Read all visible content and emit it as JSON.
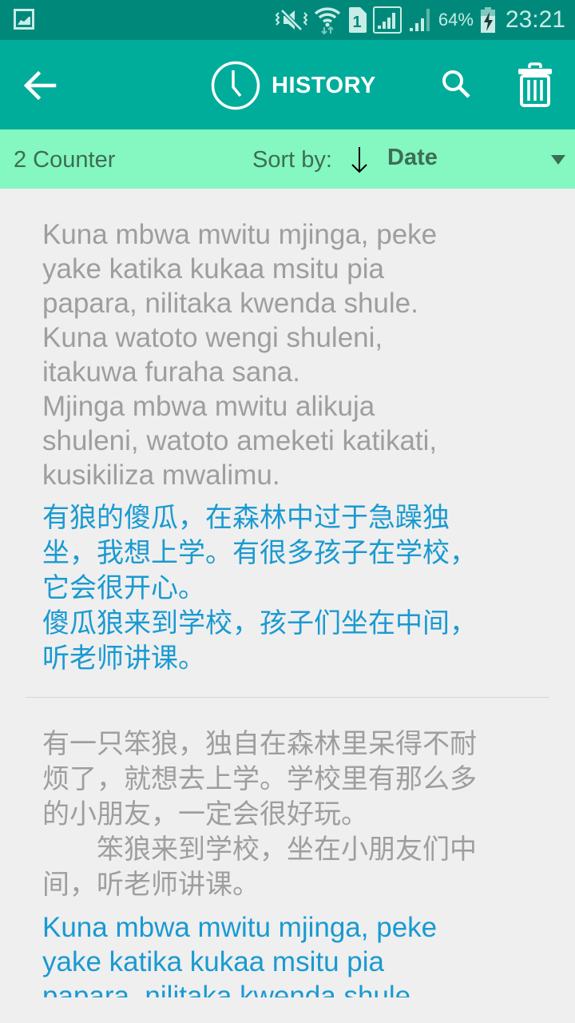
{
  "status_bar": {
    "battery": "64%",
    "time": "23:21",
    "icons": [
      "gallery-notification-icon",
      "vibrate-mute-icon",
      "wifi-icon",
      "sim1-icon",
      "signal-sim1-icon",
      "signal-sim2-icon",
      "battery-charging-icon"
    ],
    "sim_label": "1"
  },
  "app_bar": {
    "title": "HISTORY",
    "back_icon": "arrow-left-icon",
    "title_icon": "clock-icon",
    "search_icon": "search-icon",
    "delete_icon": "trash-icon"
  },
  "sort_bar": {
    "counter": "2 Counter",
    "sort_label": "Sort by:",
    "sort_direction": "descending",
    "sort_value": "Date"
  },
  "colors": {
    "status_bar": "#00897b",
    "app_bar": "#00ac9a",
    "sort_bar": "#85f7c0",
    "source_text": "#9e9e9e",
    "translation_text": "#1a9ad1"
  },
  "history": [
    {
      "source": "Kuna mbwa mwitu mjinga, peke\nyake katika kukaa msitu pia\npapara, nilitaka kwenda shule.\nKuna watoto wengi shuleni,\nitakuwa furaha sana.\nMjinga mbwa mwitu alikuja\nshuleni, watoto ameketi katikati,\nkusikiliza mwalimu.",
      "translation": "有狼的傻瓜，在森林中过于急躁独\n坐，我想上学。有很多孩子在学校，\n它会很开心。\n傻瓜狼来到学校，孩子们坐在中间，\n听老师讲课。"
    },
    {
      "source": "有一只笨狼，独自在森林里呆得不耐\n烦了，就想去上学。学校里有那么多\n的小朋友，一定会很好玩。\n　　笨狼来到学校，坐在小朋友们中\n间，听老师讲课。",
      "translation": "Kuna mbwa mwitu mjinga, peke\nyake katika kukaa msitu pia\npapara, nilitaka kwenda shule"
    }
  ]
}
